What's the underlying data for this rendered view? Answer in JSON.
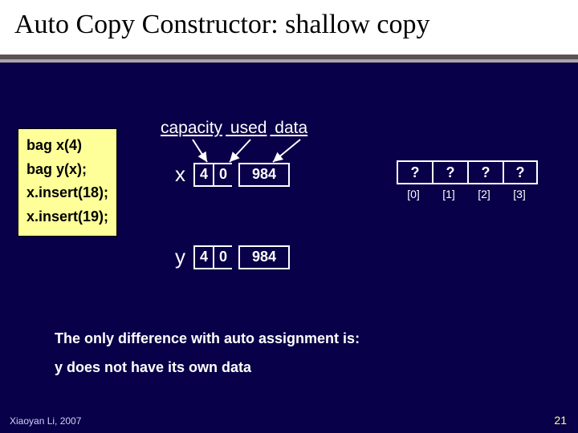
{
  "title": "Auto Copy Constructor: shallow copy",
  "code": {
    "l1": "bag x(4)",
    "l2": "bag y(x);",
    "l3": "x.insert(18);",
    "l4": "x.insert(19);"
  },
  "labels": {
    "capacity": "capacity",
    "used": "used",
    "data": "data"
  },
  "x": {
    "name": "x",
    "cap": "4",
    "used": "0",
    "ptr": "984"
  },
  "y": {
    "name": "y",
    "cap": "4",
    "used": "0",
    "ptr": "984"
  },
  "array": {
    "v0": "?",
    "v1": "?",
    "v2": "?",
    "v3": "?",
    "i0": "[0]",
    "i1": "[1]",
    "i2": "[2]",
    "i3": "[3]"
  },
  "note1": "The only difference with auto assignment is:",
  "note2": "y does not have its own data",
  "footer_left": "Xiaoyan Li, 2007",
  "footer_right": "21"
}
